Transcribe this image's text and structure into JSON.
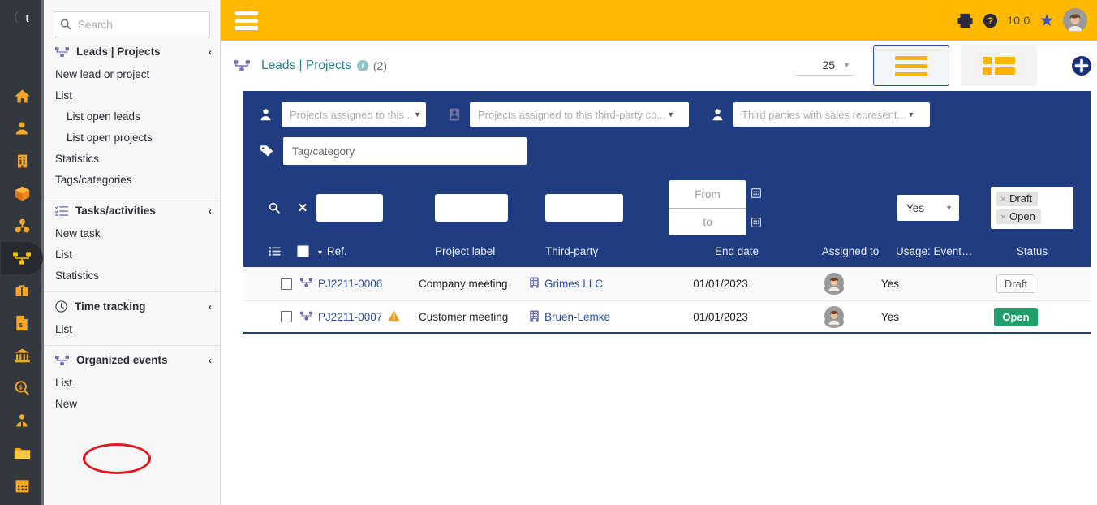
{
  "brand": {
    "logo_letter": "t",
    "accent_orange": "#f5a623",
    "accent_green": "#1c7a3e",
    "topbar_color": "#ffb900",
    "panel_color": "#1f3d80"
  },
  "rail": {
    "items": [
      {
        "name": "home-icon",
        "label": "Home"
      },
      {
        "name": "user-icon",
        "label": "Third parties"
      },
      {
        "name": "building-icon",
        "label": "Contacts"
      },
      {
        "name": "box-icon",
        "label": "Products"
      },
      {
        "name": "boxes-icon",
        "label": "Stock"
      },
      {
        "name": "project-tree-icon",
        "label": "Projects",
        "active": true
      },
      {
        "name": "briefcase-icon",
        "label": "Commercial"
      },
      {
        "name": "invoice-icon",
        "label": "Billing"
      },
      {
        "name": "bank-icon",
        "label": "Bank"
      },
      {
        "name": "money-search-icon",
        "label": "Accounting"
      },
      {
        "name": "employee-icon",
        "label": "HRM"
      },
      {
        "name": "folder-icon",
        "label": "Documents"
      },
      {
        "name": "calendar-icon",
        "label": "Agenda"
      }
    ]
  },
  "topbar": {
    "menu_label": "Menu",
    "version": "10.0",
    "print_label": "Print",
    "help_label": "Help",
    "bookmark_label": "Bookmarks",
    "user_menu_label": "User menu"
  },
  "search": {
    "placeholder": "Search",
    "value": ""
  },
  "sidebar": {
    "groups": [
      {
        "title": "Leads | Projects",
        "icon": "project-tree-icon",
        "chevron": "‹",
        "items": [
          {
            "label": "New lead or project",
            "sub": false
          },
          {
            "label": "List",
            "sub": false
          },
          {
            "label": "List open leads",
            "sub": true
          },
          {
            "label": "List open projects",
            "sub": true
          },
          {
            "label": "Statistics",
            "sub": false
          },
          {
            "label": "Tags/categories",
            "sub": false
          }
        ]
      },
      {
        "title": "Tasks/activities",
        "icon": "tasks-icon",
        "chevron": "‹",
        "items": [
          {
            "label": "New task",
            "sub": false
          },
          {
            "label": "List",
            "sub": false
          },
          {
            "label": "Statistics",
            "sub": false
          }
        ]
      },
      {
        "title": "Time tracking",
        "icon": "clock-icon",
        "chevron": "‹",
        "items": [
          {
            "label": "List",
            "sub": false
          }
        ]
      },
      {
        "title": "Organized events",
        "icon": "project-tree-icon",
        "chevron": "‹",
        "items": [
          {
            "label": "List",
            "sub": false
          },
          {
            "label": "New",
            "sub": false
          }
        ]
      }
    ]
  },
  "breadcrumb": {
    "icon": "project-tree-icon",
    "title": "Leads | Projects",
    "info_glyph": "i",
    "count": "(2)"
  },
  "toolbar": {
    "page_size": "25",
    "page_size_caret": "▼",
    "list_view_label": "List view",
    "grid_view_label": "Kanban view",
    "add_label": "New"
  },
  "filters": {
    "assigned_user": {
      "placeholder": "Projects assigned to this ...",
      "value": "",
      "icon": "user-icon"
    },
    "third_party_contact": {
      "placeholder": "Projects assigned to this third-party co...",
      "value": "",
      "icon": "contact-card-icon"
    },
    "sales_rep": {
      "placeholder": "Third parties with sales represent...",
      "value": "",
      "icon": "user-icon"
    },
    "tag_category": {
      "placeholder": "Tag/category",
      "value": "",
      "icon": "tag-icon"
    },
    "search_label": "Search",
    "clear_label": "Clear",
    "ref": "",
    "project_label": "",
    "third_party": "",
    "date_from_placeholder": "From",
    "date_to_placeholder": "to",
    "usage_event": "Yes",
    "status_chips": [
      {
        "label": "Draft",
        "remove": "×"
      },
      {
        "label": "Open",
        "remove": "×"
      }
    ]
  },
  "table": {
    "columns": [
      {
        "key": "select_all",
        "label": ""
      },
      {
        "key": "ref",
        "label": "Ref.",
        "sorted": true,
        "sort_arrow": "▼"
      },
      {
        "key": "project_label",
        "label": "Project label"
      },
      {
        "key": "third_party",
        "label": "Third-party"
      },
      {
        "key": "end_date",
        "label": "End date"
      },
      {
        "key": "assigned_to",
        "label": "Assigned to"
      },
      {
        "key": "usage_event",
        "label": "Usage: Event…"
      },
      {
        "key": "status",
        "label": "Status"
      }
    ],
    "rows": [
      {
        "checked": false,
        "ref": "PJ2211-0006",
        "ref_icon": "project-tree-icon",
        "warning": false,
        "project_label": "Company meeting",
        "third_party": "Grimes LLC",
        "third_party_icon": "building-icon",
        "end_date": "01/01/2023",
        "assigned_to": "avatar",
        "usage_event": "Yes",
        "status": "Draft",
        "status_kind": "draft"
      },
      {
        "checked": false,
        "ref": "PJ2211-0007",
        "ref_icon": "project-tree-icon",
        "warning": true,
        "warning_glyph": "⚠",
        "project_label": "Customer meeting",
        "third_party": "Bruen-Lemke",
        "third_party_icon": "building-icon",
        "end_date": "01/01/2023",
        "assigned_to": "avatar",
        "usage_event": "Yes",
        "status": "Open",
        "status_kind": "open"
      }
    ]
  },
  "annotation": {
    "shape": "ellipse",
    "color": "#e8161b",
    "targets": "sidebar-item-organized-events-list"
  }
}
